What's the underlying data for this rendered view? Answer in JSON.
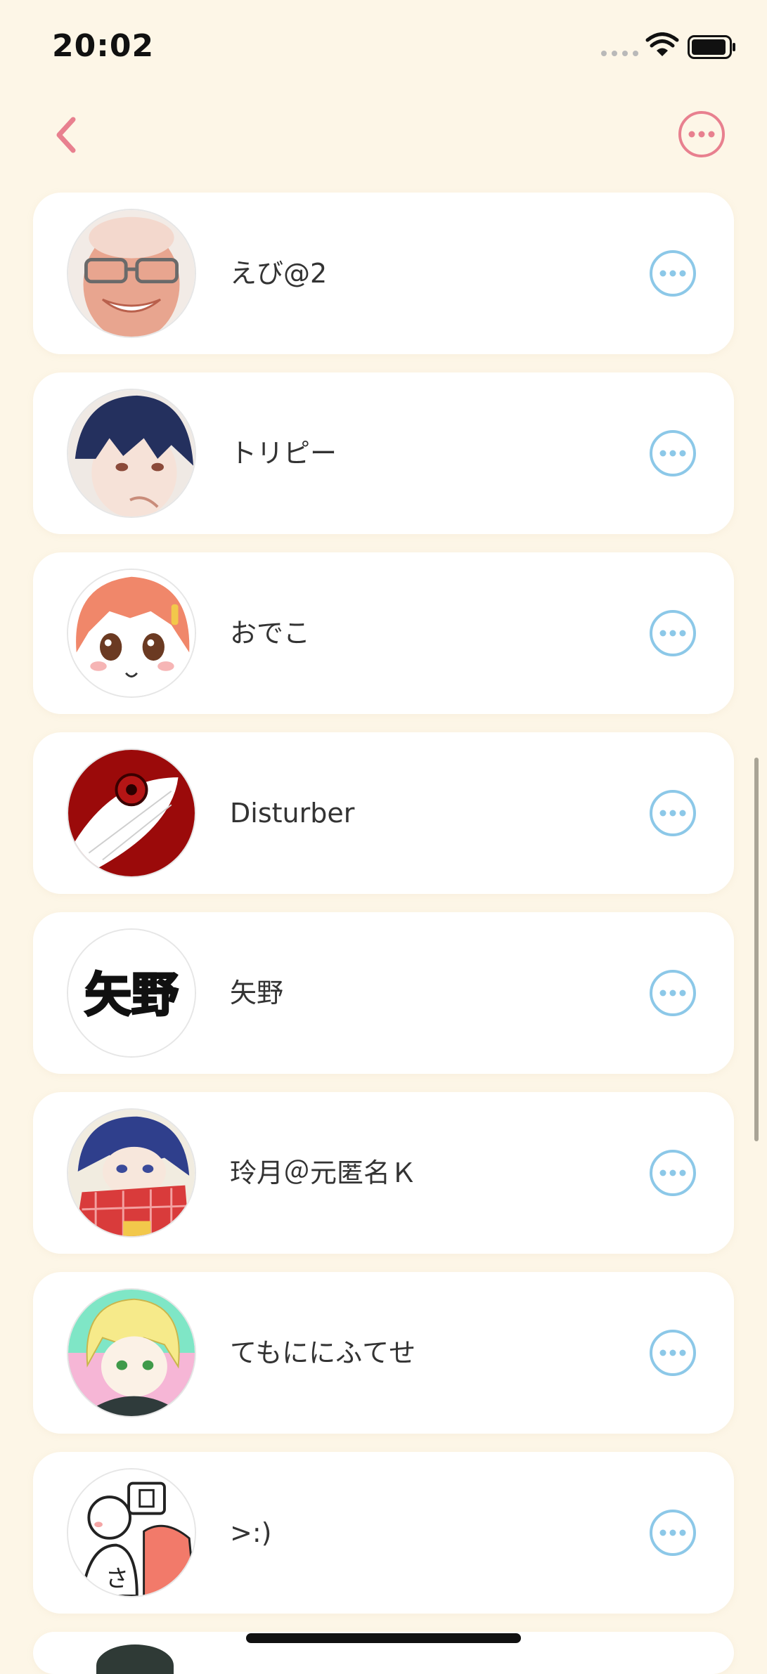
{
  "status_bar": {
    "time": "20:02"
  },
  "contacts": [
    {
      "name": "えび@2",
      "avatar": "face-photo-avatar"
    },
    {
      "name": "トリピー",
      "avatar": "anime-boy-avatar"
    },
    {
      "name": "おでこ",
      "avatar": "anime-girl-avatar"
    },
    {
      "name": "Disturber",
      "avatar": "eye-avatar"
    },
    {
      "name": "矢野",
      "avatar": "kanji-avatar",
      "avatar_text": "矢野"
    },
    {
      "name": "玲月＠元匿名Ｋ",
      "avatar": "scarf-boy-avatar"
    },
    {
      "name": "てもににふてせ",
      "avatar": "blonde-boy-avatar"
    },
    {
      "name": ">:)",
      "avatar": "doodle-avatar",
      "avatar_text": "さ"
    }
  ],
  "colors": {
    "background": "#fdf6e7",
    "card": "#ffffff",
    "accent_pink": "#e8808f",
    "accent_blue": "#8cc8e8"
  }
}
